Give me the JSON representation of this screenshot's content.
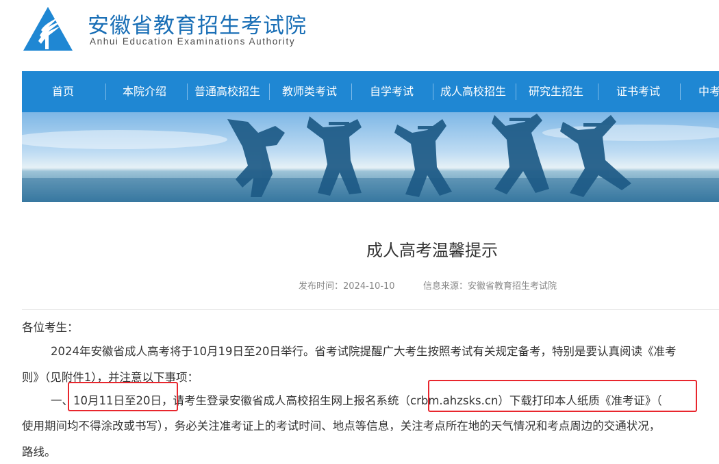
{
  "header": {
    "title": "安徽省教育招生考试院",
    "subtitle": "Anhui Education Examinations Authority"
  },
  "nav": {
    "items": [
      "首页",
      "本院介绍",
      "普通高校招生",
      "教师类考试",
      "自学考试",
      "成人高校招生",
      "研究生招生",
      "证书考试",
      "中考"
    ]
  },
  "article": {
    "title": "成人高考温馨提示",
    "publish_time": "发布时间：2024-10-10",
    "source": "信息来源：安徽省教育招生考试院",
    "greeting": "各位考生：",
    "p1_line1": "2024年安徽省成人高考将于10月19日至20日举行。省考试院提醒广大考生按照考试有关规定备考，特别是要认真阅读《准考",
    "p1_line2": "则》（见附件1），并注意以下事项：",
    "p2_prefix": "一、",
    "p2_date": "10月11日至20日",
    "p2_middle": "，请考生登录安徽省成人高校招生网上报名系统",
    "p2_url": "（crbm.ahzsks.cn）",
    "p2_suffix": "下载打印本人纸质《准考证》（",
    "p2_line2": "使用期间均不得涂改或书写），务必关注准考证上的考试时间、地点等信息，关注考点所在地的天气情况和考点周边的交通状况，",
    "p2_line3": "路线。"
  },
  "colors": {
    "brand_blue": "#1a6fb6",
    "nav_blue": "#1f87d3",
    "highlight_red": "#e8262d"
  }
}
